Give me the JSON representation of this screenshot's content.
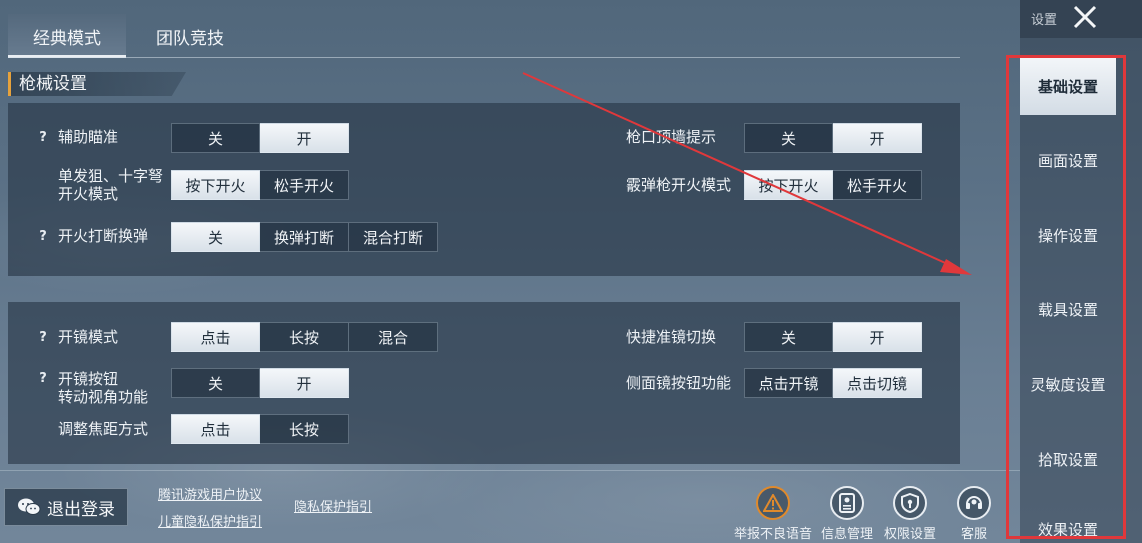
{
  "tabs": [
    {
      "label": "经典模式"
    },
    {
      "label": "团队竞技"
    }
  ],
  "section": {
    "title": "枪械设置"
  },
  "panel1": {
    "left": [
      {
        "help": "?",
        "label": "辅助瞄准",
        "options": [
          "关",
          "开"
        ],
        "selected": 1
      },
      {
        "help": "",
        "label_l1": "单发狙、十字弩",
        "label_l2": "开火模式",
        "options": [
          "按下开火",
          "松手开火"
        ],
        "selected": 0
      },
      {
        "help": "?",
        "label": "开火打断换弹",
        "options": [
          "关",
          "换弹打断",
          "混合打断"
        ],
        "selected": 0
      }
    ],
    "right": [
      {
        "label": "枪口顶墙提示",
        "options": [
          "关",
          "开"
        ],
        "selected": 1
      },
      {
        "label": "霰弹枪开火模式",
        "options": [
          "按下开火",
          "松手开火"
        ],
        "selected": 0
      }
    ]
  },
  "panel2": {
    "left": [
      {
        "help": "?",
        "label": "开镜模式",
        "options": [
          "点击",
          "长按",
          "混合"
        ],
        "selected": 0
      },
      {
        "help": "?",
        "label_l1": "开镜按钮",
        "label_l2": "转动视角功能",
        "options": [
          "关",
          "开"
        ],
        "selected": 1
      },
      {
        "help": "",
        "label": "调整焦距方式",
        "options": [
          "点击",
          "长按"
        ],
        "selected": 0
      }
    ],
    "right": [
      {
        "label": "快捷准镜切换",
        "options": [
          "关",
          "开"
        ],
        "selected": 1
      },
      {
        "label": "侧面镜按钮功能",
        "options": [
          "点击开镜",
          "点击切镜"
        ],
        "selected": 1
      }
    ]
  },
  "bottom": {
    "logout_label": "退出登录",
    "links": [
      "腾讯游戏用户协议",
      "儿童隐私保护指引",
      "隐私保护指引"
    ],
    "icons": [
      {
        "label": "举报不良语音",
        "icon": "warning-icon"
      },
      {
        "label": "信息管理",
        "icon": "id-card-icon"
      },
      {
        "label": "权限设置",
        "icon": "shield-icon"
      },
      {
        "label": "客服",
        "icon": "headset-icon"
      }
    ]
  },
  "sidebar": {
    "title": "设置",
    "items": [
      {
        "label": "基础设置"
      },
      {
        "label": "画面设置"
      },
      {
        "label": "操作设置"
      },
      {
        "label": "载具设置"
      },
      {
        "label": "灵敏度设置"
      },
      {
        "label": "拾取设置"
      },
      {
        "label": "效果设置"
      }
    ],
    "active_index": 0
  },
  "colors": {
    "annotation": "#e0383b",
    "accent": "#e6a23c"
  }
}
